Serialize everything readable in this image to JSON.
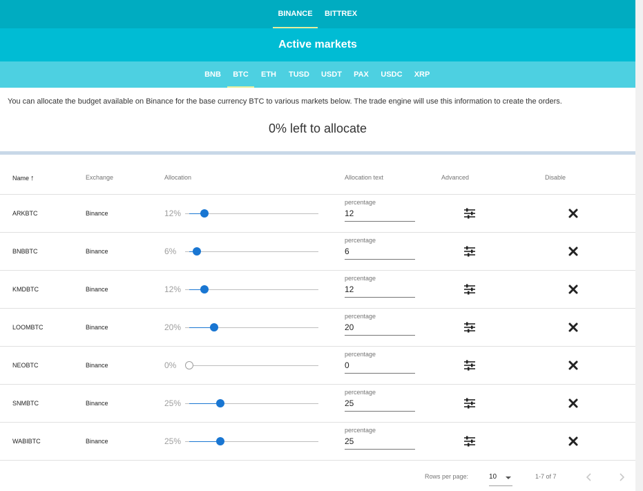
{
  "exchange_tabs": [
    {
      "label": "BINANCE",
      "active": true
    },
    {
      "label": "BITTREX",
      "active": false
    }
  ],
  "title": "Active markets",
  "currency_tabs": [
    {
      "label": "BNB",
      "active": false
    },
    {
      "label": "BTC",
      "active": true
    },
    {
      "label": "ETH",
      "active": false
    },
    {
      "label": "TUSD",
      "active": false
    },
    {
      "label": "USDT",
      "active": false
    },
    {
      "label": "PAX",
      "active": false
    },
    {
      "label": "USDC",
      "active": false
    },
    {
      "label": "XRP",
      "active": false
    }
  ],
  "description": "You can allocate the budget available on Binance for the base currency BTC to various markets below. The trade engine will use this information to create the orders.",
  "left_to_allocate": "0% left to allocate",
  "table": {
    "headers": {
      "name": "Name",
      "name_sort_icon": "arrow-up-icon",
      "exchange": "Exchange",
      "allocation": "Allocation",
      "allocation_text": "Allocation text",
      "advanced": "Advanced",
      "disable": "Disable"
    },
    "field_label": "percentage",
    "rows": [
      {
        "name": "ARKBTC",
        "exchange": "Binance",
        "allocation_pct": "12%",
        "allocation_value": "12",
        "slider_fraction": 0.12
      },
      {
        "name": "BNBBTC",
        "exchange": "Binance",
        "allocation_pct": "6%",
        "allocation_value": "6",
        "slider_fraction": 0.06
      },
      {
        "name": "KMDBTC",
        "exchange": "Binance",
        "allocation_pct": "12%",
        "allocation_value": "12",
        "slider_fraction": 0.12
      },
      {
        "name": "LOOMBTC",
        "exchange": "Binance",
        "allocation_pct": "20%",
        "allocation_value": "20",
        "slider_fraction": 0.2
      },
      {
        "name": "NEOBTC",
        "exchange": "Binance",
        "allocation_pct": "0%",
        "allocation_value": "0",
        "slider_fraction": 0.0
      },
      {
        "name": "SNMBTC",
        "exchange": "Binance",
        "allocation_pct": "25%",
        "allocation_value": "25",
        "slider_fraction": 0.25
      },
      {
        "name": "WABIBTC",
        "exchange": "Binance",
        "allocation_pct": "25%",
        "allocation_value": "25",
        "slider_fraction": 0.25
      }
    ]
  },
  "footer": {
    "rows_per_page_label": "Rows per page:",
    "rows_per_page_value": "10",
    "range": "1-7 of 7"
  },
  "colors": {
    "exchange_bar": "#00acc1",
    "title_bar": "#00bcd4",
    "currency_bar": "#4dd0e1",
    "slider_accent": "#1976d2",
    "tab_underline": "#e6ee9c"
  },
  "icons": {
    "advanced": "tune-sliders-icon",
    "disable": "close-x-icon",
    "prev": "chevron-left-icon",
    "next": "chevron-right-icon"
  }
}
